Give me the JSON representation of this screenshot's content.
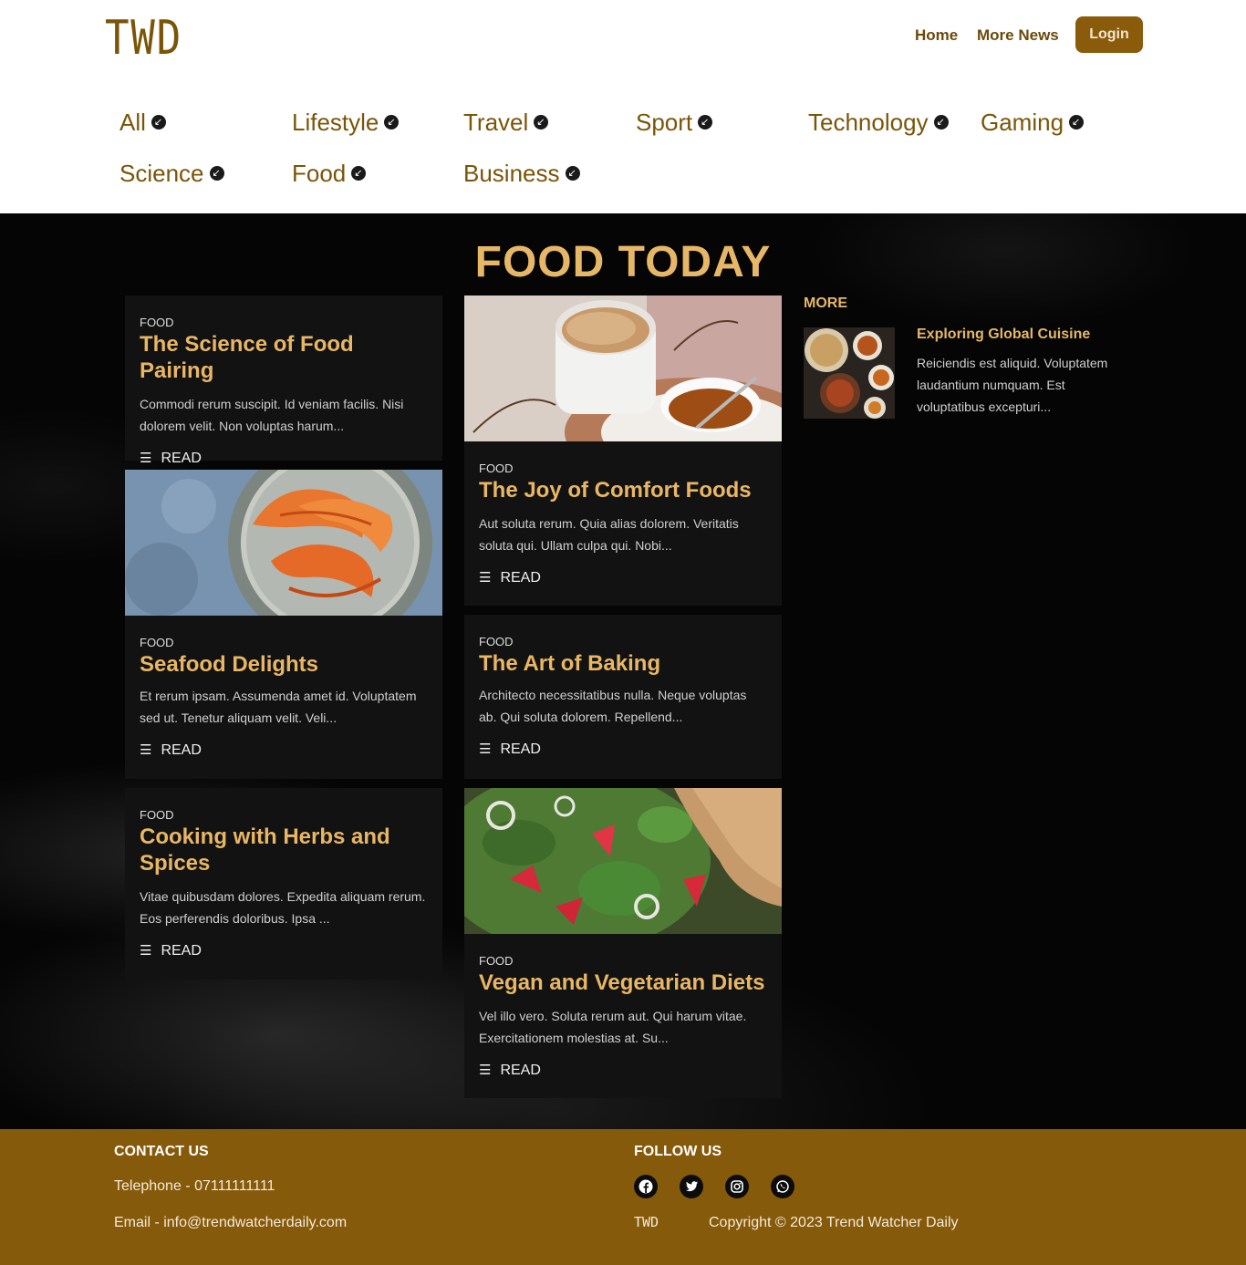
{
  "header": {
    "logo": "TWD",
    "nav": {
      "home": "Home",
      "more_news": "More News",
      "login": "Login"
    },
    "categories": [
      "All",
      "Lifestyle",
      "Travel",
      "Sport",
      "Technology",
      "Gaming",
      "Science",
      "Food",
      "Business"
    ]
  },
  "main": {
    "title": "FOOD TODAY",
    "read_label": "READ",
    "cards": [
      {
        "category": "FOOD",
        "title": "The Science of Food Pairing",
        "text": "Commodi rerum suscipit. Id veniam facilis. Nisi dolorem velit. Non voluptas harum...",
        "image": "none"
      },
      {
        "category": "FOOD",
        "title": "Seafood Delights",
        "text": "Et rerum ipsam. Assumenda amet id. Voluptatem sed ut. Tenetur aliquam velit. Veli...",
        "image": "shrimp"
      },
      {
        "category": "FOOD",
        "title": "Cooking with Herbs and Spices",
        "text": "Vitae quibusdam dolores. Expedita aliquam rerum. Eos perferendis doloribus. Ipsa ...",
        "image": "none"
      },
      {
        "category": "FOOD",
        "title": "The Joy of Comfort Foods",
        "text": "Aut soluta rerum. Quia alias dolorem. Veritatis soluta qui. Ullam culpa qui. Nobi...",
        "image": "coffee"
      },
      {
        "category": "FOOD",
        "title": "The Art of Baking",
        "text": "Architecto necessitatibus nulla. Neque voluptas ab. Qui soluta dolorem. Repellend...",
        "image": "none"
      },
      {
        "category": "FOOD",
        "title": "Vegan and Vegetarian Diets",
        "text": "Vel illo vero. Soluta rerum aut. Qui harum vitae. Exercitationem molestias at. Su...",
        "image": "salad"
      }
    ],
    "more": {
      "heading": "MORE",
      "items": [
        {
          "title": "Exploring Global Cuisine",
          "text": "Reiciendis est aliquid. Voluptatem laudantium numquam. Est voluptatibus excepturi...",
          "image": "dishes"
        }
      ]
    }
  },
  "footer": {
    "contact_heading": "CONTACT US",
    "telephone": "Telephone - 07111111111",
    "email": "Email - info@trendwatcherdaily.com",
    "follow_heading": "FOLLOW US",
    "social_icons": [
      "facebook-icon",
      "twitter-icon",
      "instagram-icon",
      "whatsapp-icon"
    ],
    "logo": "TWD",
    "copyright": "Copyright © 2023 Trend Watcher Daily"
  },
  "colors": {
    "brand": "#865a0b",
    "accent": "#e6b766",
    "background": "#050505"
  }
}
